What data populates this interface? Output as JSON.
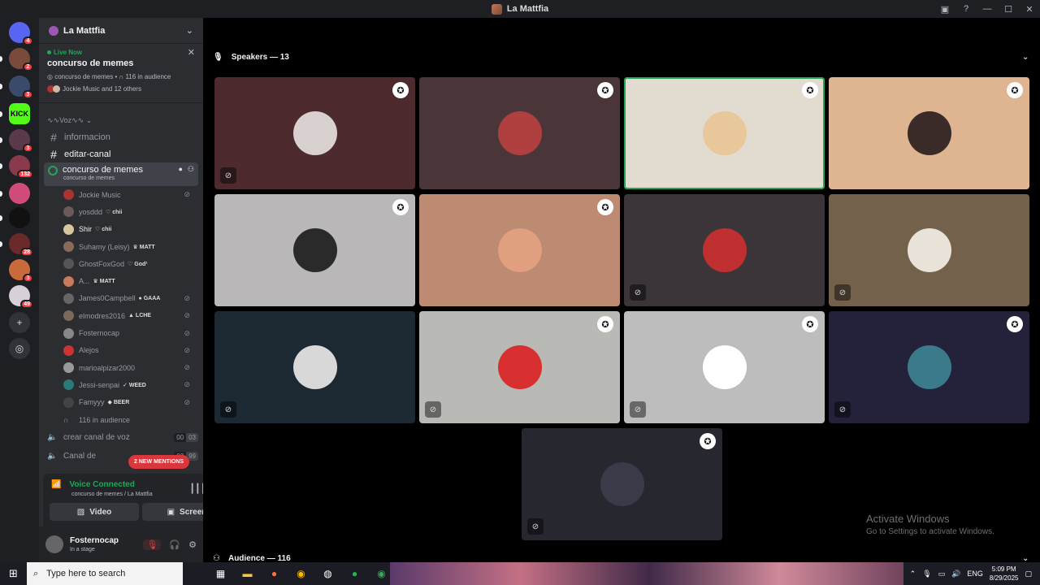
{
  "window": {
    "title": "La Mattfia"
  },
  "guilds": [
    {
      "name": "discord-home",
      "badge": "4",
      "color": "#5865f2"
    },
    {
      "name": "server",
      "badge": "2",
      "color": "#7a4b3a"
    },
    {
      "name": "server",
      "badge": "3",
      "color": "#3a4a6a"
    },
    {
      "name": "kick",
      "badge": "",
      "color": "#53fc18",
      "text": "KICK"
    },
    {
      "name": "server",
      "badge": "3",
      "color": "#5a3a4a"
    },
    {
      "name": "server",
      "badge": "132",
      "color": "#8a3a4a"
    },
    {
      "name": "server",
      "badge": "",
      "color": "#d04a7a"
    },
    {
      "name": "server",
      "badge": "",
      "color": "#111111"
    },
    {
      "name": "server",
      "badge": "28",
      "color": "#6a2a2a"
    },
    {
      "name": "server",
      "badge": "3",
      "color": "#c86a3a"
    },
    {
      "name": "server",
      "badge": "49",
      "color": "#d8d0d8"
    }
  ],
  "server": {
    "name": "La Mattfia"
  },
  "live": {
    "label": "Live Now",
    "title": "concurso de memes",
    "stats_channel": "concurso de memes",
    "stats_audience": "116 in audience",
    "participants": "Jockie Music and 12 others"
  },
  "category": "∿∿Voz∿∿",
  "channels": {
    "informacion": "informacion",
    "editar": "editar-canal",
    "stage": "concurso de memes",
    "stage_sub": "concurso de memes"
  },
  "members": [
    {
      "name": "Jockie Music",
      "tag": "",
      "muted": false,
      "white": false,
      "color": "#a33"
    },
    {
      "name": "yosddd",
      "tag": "♡ chii",
      "muted": false,
      "white": false,
      "color": "#6a5a5a"
    },
    {
      "name": "Shir",
      "tag": "♡ chii",
      "muted": false,
      "white": true,
      "color": "#d9c5a0"
    },
    {
      "name": "Suhamy (Leisy)",
      "tag": "♛ MATT",
      "muted": false,
      "white": false,
      "color": "#8a6a5a"
    },
    {
      "name": "GhostFoxGod",
      "tag": "♡ God¹",
      "muted": false,
      "white": false,
      "color": "#555"
    },
    {
      "name": "A...",
      "tag": "♛ MATT",
      "muted": false,
      "white": false,
      "color": "#c87a5a"
    },
    {
      "name": "James0Campbell",
      "tag": "● GAAA",
      "muted": true,
      "white": false,
      "color": "#666"
    },
    {
      "name": "elmodres2016",
      "tag": "▲ LCHE",
      "muted": true,
      "white": false,
      "color": "#7a6a5a"
    },
    {
      "name": "Fosternocap",
      "tag": "",
      "muted": true,
      "white": false,
      "color": "#888"
    },
    {
      "name": "Alejos",
      "tag": "",
      "muted": true,
      "white": false,
      "color": "#c33"
    },
    {
      "name": "marioalpizar2000",
      "tag": "",
      "muted": true,
      "white": false,
      "color": "#999"
    },
    {
      "name": "Jessi-senpai",
      "tag": "✓ WEED",
      "muted": true,
      "white": false,
      "color": "#2a7a7a"
    },
    {
      "name": "Famyyy",
      "tag": "◆ BEER",
      "muted": true,
      "white": false,
      "color": "#444"
    }
  ],
  "audience_row": "116 in audience",
  "voice_channels": [
    {
      "name": "crear canal de voz",
      "a": "00",
      "b": "03"
    },
    {
      "name": "Canal de",
      "a": "02",
      "b": "99"
    }
  ],
  "mentions": "2 NEW MENTIONS",
  "voice": {
    "status": "Voice Connected",
    "location": "concurso de memes / La Mattfia",
    "video": "Video",
    "screen": "Screen"
  },
  "user": {
    "name": "Fosternocap",
    "status": "In a stage"
  },
  "speakers_header": "Speakers — 13",
  "audience_header": "Audience — 116",
  "tiles": [
    {
      "bg": "#4d2a2e",
      "pic": "#d9d0d0",
      "mod": true,
      "mute": true,
      "speaking": false
    },
    {
      "bg": "#4a3538",
      "pic": "#b04040",
      "mod": true,
      "mute": false,
      "speaking": false
    },
    {
      "bg": "#e2dbd0",
      "pic": "#e8c89a",
      "mod": true,
      "mute": false,
      "speaking": true
    },
    {
      "bg": "#dfb591",
      "pic": "#3a2a28",
      "mod": true,
      "mute": false,
      "speaking": false
    },
    {
      "bg": "#b9b7b7",
      "pic": "#2a2a2a",
      "mod": true,
      "mute": false,
      "speaking": false
    },
    {
      "bg": "#bd8a72",
      "pic": "#e0a080",
      "mod": true,
      "mute": false,
      "speaking": false
    },
    {
      "bg": "#3b3439",
      "pic": "#c03030",
      "mod": false,
      "mute": true,
      "speaking": false
    },
    {
      "bg": "#73614c",
      "pic": "#e8e2d8",
      "mod": false,
      "mute": true,
      "speaking": false
    },
    {
      "bg": "#1c2832",
      "pic": "#d8d8d8",
      "mod": false,
      "mute": true,
      "speaking": false
    },
    {
      "bg": "#b9b9b5",
      "pic": "#d83030",
      "mod": true,
      "mute": true,
      "speaking": false
    },
    {
      "bg": "#bdbdbd",
      "pic": "#ffffff",
      "mod": true,
      "mute": true,
      "speaking": false
    },
    {
      "bg": "#23223a",
      "pic": "#3a7a8a",
      "mod": true,
      "mute": true,
      "speaking": false
    },
    {
      "bg": "#272730",
      "pic": "#3a3a48",
      "mod": true,
      "mute": true,
      "speaking": false
    }
  ],
  "watermark": {
    "title": "Activate Windows",
    "subtitle": "Go to Settings to activate Windows."
  },
  "taskbar": {
    "search_placeholder": "Type here to search",
    "lang": "ENG",
    "time": "5:09 PM",
    "date": "8/29/2025"
  }
}
